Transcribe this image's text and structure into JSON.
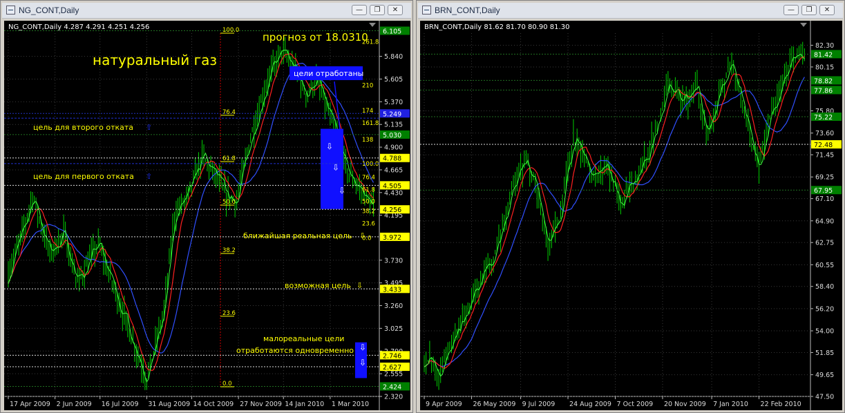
{
  "windows": [
    {
      "id": "ng",
      "title": "NG_CONT,Daily",
      "buttons": [
        "minimize-button",
        "restore-button",
        "close-button"
      ]
    },
    {
      "id": "brn",
      "title": "BRN_CONT,Daily",
      "buttons": [
        "minimize-button",
        "restore-button",
        "close-button"
      ]
    }
  ],
  "chart_data": [
    {
      "type": "candlestick",
      "symbol": "NG_CONT",
      "header": "NG_CONT,Daily  4.287 4.291 4.251 4.256",
      "ylim": [
        2.32,
        6.08
      ],
      "y_ticks": [
        "5.840",
        "5.605",
        "5.370",
        "5.135",
        "4.900",
        "4.665",
        "4.430",
        "4.195",
        "3.730",
        "3.495",
        "3.260",
        "3.025",
        "2.790",
        "2.555",
        "2.320"
      ],
      "x_ticks": [
        "17 Apr 2009",
        "2 Jun 2009",
        "16 Jul 2009",
        "31 Aug 2009",
        "14 Oct 2009",
        "27 Nov 2009",
        "14 Jan 2010",
        "1 Mar 2010"
      ],
      "price_labels": [
        {
          "value": 6.105,
          "text": "6.105",
          "style": "green"
        },
        {
          "value": 5.249,
          "text": "5.249",
          "style": "blue"
        },
        {
          "value": 5.03,
          "text": "5.030",
          "style": "green"
        },
        {
          "value": 4.788,
          "text": "4.788",
          "style": "yellow"
        },
        {
          "value": 4.505,
          "text": "4.505",
          "style": "yellow"
        },
        {
          "value": 4.256,
          "text": "4.256",
          "style": "yellow"
        },
        {
          "value": 3.972,
          "text": "3.972",
          "style": "yellow"
        },
        {
          "value": 3.433,
          "text": "3.433",
          "style": "yellow"
        },
        {
          "value": 2.746,
          "text": "2.746",
          "style": "yellow"
        },
        {
          "value": 2.627,
          "text": "2.627",
          "style": "yellow"
        },
        {
          "value": 2.424,
          "text": "2.424",
          "style": "green"
        }
      ],
      "fib_left": [
        {
          "value": 6.08,
          "text": "100.0"
        },
        {
          "value": 5.23,
          "text": "76.4"
        },
        {
          "value": 4.75,
          "text": "61.8"
        },
        {
          "value": 4.3,
          "text": "50.0"
        },
        {
          "value": 3.8,
          "text": "38.2"
        },
        {
          "value": 3.15,
          "text": "23.6"
        },
        {
          "value": 2.42,
          "text": "0.0"
        }
      ],
      "fib_right": [
        {
          "value": 5.99,
          "text": "261.8"
        },
        {
          "value": 5.54,
          "text": "210"
        },
        {
          "value": 5.28,
          "text": "174"
        },
        {
          "value": 5.15,
          "text": "161.8"
        },
        {
          "value": 4.98,
          "text": "138"
        },
        {
          "value": 4.73,
          "text": "100.0"
        },
        {
          "value": 4.59,
          "text": "76.4"
        },
        {
          "value": 4.46,
          "text": "61.8"
        },
        {
          "value": 4.34,
          "text": "50.0"
        },
        {
          "value": 4.24,
          "text": "38.2"
        },
        {
          "value": 4.11,
          "text": "23.6"
        },
        {
          "value": 3.96,
          "text": "0.0"
        }
      ],
      "annotations": {
        "title": "натуральный газ",
        "forecast": "прогноз от 18.0310",
        "targets_done": "цели отработаны",
        "second_pullback": "цель для второго отката",
        "first_pullback": "цель для первого отката",
        "nearest_target": "ближайшая реальная цель",
        "possible_target": "возможная цель",
        "unlikely_1": "малореальные цели",
        "unlikely_2": "отработаются одновременно"
      },
      "key_points": [
        [
          0,
          3.6
        ],
        [
          8,
          4.0
        ],
        [
          14,
          4.4
        ],
        [
          24,
          3.8
        ],
        [
          32,
          4.0
        ],
        [
          40,
          3.5
        ],
        [
          52,
          3.9
        ],
        [
          60,
          3.5
        ],
        [
          72,
          2.9
        ],
        [
          80,
          2.5
        ],
        [
          90,
          3.2
        ],
        [
          96,
          4.2
        ],
        [
          104,
          4.4
        ],
        [
          112,
          4.8
        ],
        [
          120,
          4.6
        ],
        [
          126,
          4.4
        ],
        [
          132,
          4.35
        ],
        [
          140,
          5.0
        ],
        [
          150,
          5.6
        ],
        [
          158,
          5.9
        ],
        [
          166,
          5.7
        ],
        [
          172,
          5.45
        ],
        [
          178,
          5.6
        ],
        [
          184,
          5.3
        ],
        [
          190,
          5.0
        ],
        [
          196,
          4.65
        ],
        [
          202,
          4.5
        ],
        [
          208,
          4.35
        ],
        [
          212,
          4.26
        ]
      ],
      "bars": 212
    },
    {
      "type": "candlestick",
      "symbol": "BRN_CONT",
      "header": "BRN_CONT,Daily  81.62 81.70 80.90 81.30",
      "ylim": [
        47.5,
        83.5
      ],
      "y_ticks": [
        "82.30",
        "80.15",
        "75.80",
        "73.60",
        "71.45",
        "69.25",
        "67.10",
        "64.90",
        "62.75",
        "60.55",
        "58.40",
        "56.20",
        "54.00",
        "51.85",
        "49.65",
        "47.50"
      ],
      "x_ticks": [
        "9 Apr 2009",
        "26 May 2009",
        "9 Jul 2009",
        "24 Aug 2009",
        "7 Oct 2009",
        "20 Nov 2009",
        "7 Jan 2010",
        "22 Feb 2010"
      ],
      "price_labels": [
        {
          "value": 81.42,
          "text": "81.42",
          "style": "green"
        },
        {
          "value": 78.82,
          "text": "78.82",
          "style": "green"
        },
        {
          "value": 77.86,
          "text": "77.86",
          "style": "green"
        },
        {
          "value": 75.22,
          "text": "75.22",
          "style": "green"
        },
        {
          "value": 72.48,
          "text": "72.48",
          "style": "yellow"
        },
        {
          "value": 67.95,
          "text": "67.95",
          "style": "green"
        }
      ],
      "key_points": [
        [
          0,
          51.5
        ],
        [
          8,
          49.8
        ],
        [
          14,
          52.5
        ],
        [
          22,
          55.5
        ],
        [
          32,
          59.0
        ],
        [
          40,
          62.0
        ],
        [
          48,
          68.0
        ],
        [
          56,
          71.0
        ],
        [
          62,
          68.0
        ],
        [
          68,
          62.0
        ],
        [
          74,
          65.0
        ],
        [
          82,
          73.0
        ],
        [
          88,
          71.0
        ],
        [
          94,
          69.0
        ],
        [
          100,
          70.5
        ],
        [
          108,
          67.0
        ],
        [
          116,
          68.5
        ],
        [
          124,
          72.0
        ],
        [
          134,
          78.5
        ],
        [
          142,
          76.5
        ],
        [
          150,
          78.0
        ],
        [
          156,
          73.5
        ],
        [
          162,
          77.0
        ],
        [
          168,
          80.5
        ],
        [
          172,
          78.5
        ],
        [
          178,
          74.0
        ],
        [
          184,
          70.5
        ],
        [
          188,
          74.0
        ],
        [
          194,
          77.5
        ],
        [
          200,
          80.0
        ],
        [
          206,
          81.5
        ],
        [
          210,
          81.3
        ]
      ],
      "bars": 210
    }
  ],
  "colors": {
    "bars": "#00d000",
    "ma_fast": "#ff2020",
    "ma_slow": "#3050ff",
    "grid": "#3a3a3a",
    "yellow_text": "#ffff00",
    "fib_red": "#d00000",
    "blue_box": "#1010ff"
  }
}
